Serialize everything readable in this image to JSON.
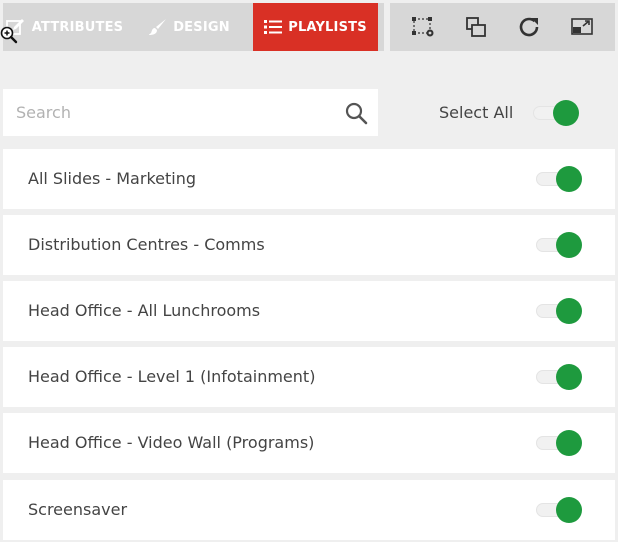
{
  "tabs": {
    "attributes": "ATTRIBUTES",
    "design": "DESIGN",
    "playlists": "PLAYLISTS"
  },
  "colors": {
    "active_tab": "#d93025",
    "toggle_on": "#1e9a3e",
    "bar_bg": "#d7d7d7"
  },
  "toolbar": {
    "icons": [
      "select-region-icon",
      "layers-icon",
      "refresh-icon",
      "preview-icon"
    ]
  },
  "search": {
    "placeholder": "Search",
    "value": ""
  },
  "select_all": {
    "label": "Select All",
    "on": true
  },
  "playlists": [
    {
      "name": "All Slides - Marketing",
      "on": true
    },
    {
      "name": "Distribution Centres - Comms",
      "on": true
    },
    {
      "name": "Head Office - All Lunchrooms",
      "on": true
    },
    {
      "name": "Head Office - Level 1 (Infotainment)",
      "on": true
    },
    {
      "name": "Head Office - Video Wall (Programs)",
      "on": true
    },
    {
      "name": "Screensaver",
      "on": true
    }
  ]
}
